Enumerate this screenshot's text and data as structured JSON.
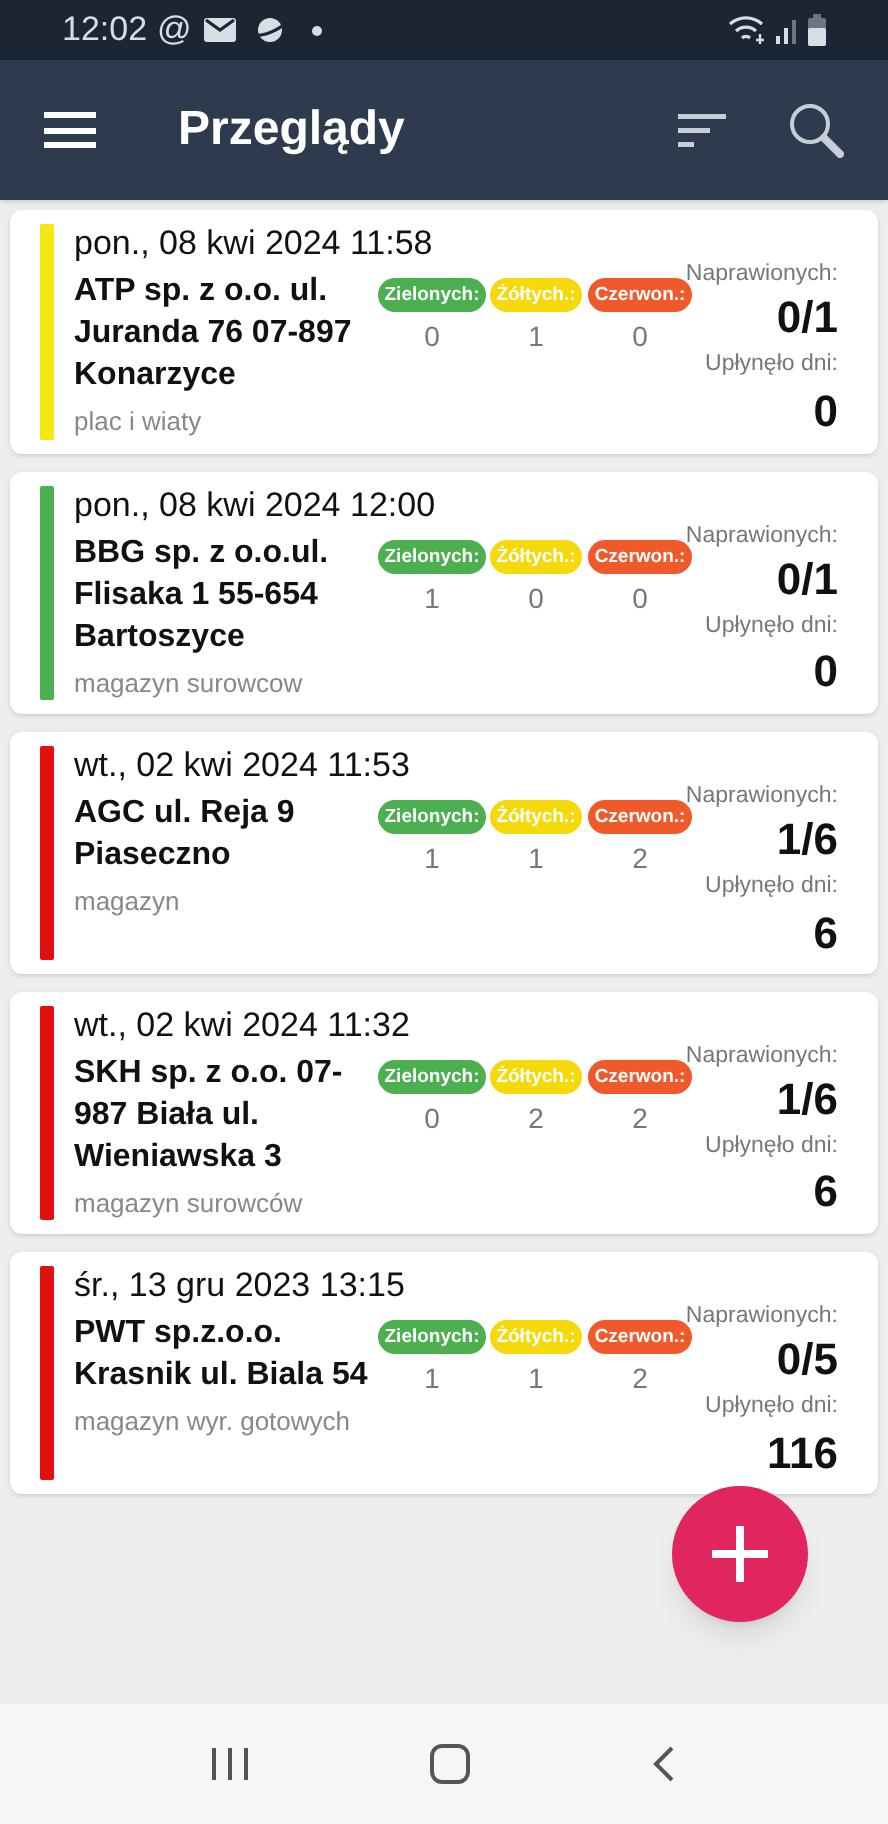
{
  "status_bar": {
    "time": "12:02",
    "at": "@"
  },
  "app_bar": {
    "title": "Przeglądy"
  },
  "inspections": [
    {
      "color": "#f5e614",
      "date": "pon., 08 kwi 2024 11:58",
      "name": "ATP sp. z o.o. ul. Juranda 76 07-897 Konarzyce",
      "location": "plac i wiaty",
      "badges": [
        {
          "label": "Zielonych:",
          "color": "#4caf50",
          "count": "0"
        },
        {
          "label": "Żółtych.:",
          "color": "#f5d90a",
          "count": "1"
        },
        {
          "label": "Czerwon.:",
          "color": "#f0592a",
          "count": "0"
        }
      ],
      "repaired_label": "Naprawionych:",
      "repaired": "0/1",
      "days_label": "Upłynęło dni:",
      "days": "0"
    },
    {
      "color": "#4caf50",
      "date": "pon., 08 kwi 2024 12:00",
      "name": "BBG sp. z o.o.ul. Flisaka 1 55-654 Bartoszyce",
      "location": "magazyn surowcow",
      "badges": [
        {
          "label": "Zielonych:",
          "color": "#4caf50",
          "count": "1"
        },
        {
          "label": "Żółtych.:",
          "color": "#f5d90a",
          "count": "0"
        },
        {
          "label": "Czerwon.:",
          "color": "#f0592a",
          "count": "0"
        }
      ],
      "repaired_label": "Naprawionych:",
      "repaired": "0/1",
      "days_label": "Upłynęło dni:",
      "days": "0"
    },
    {
      "color": "#e01010",
      "date": "wt., 02 kwi 2024 11:53",
      "name": "AGC ul. Reja 9 Piaseczno",
      "location": "magazyn",
      "badges": [
        {
          "label": "Zielonych:",
          "color": "#4caf50",
          "count": "1"
        },
        {
          "label": "Żółtych.:",
          "color": "#f5d90a",
          "count": "1"
        },
        {
          "label": "Czerwon.:",
          "color": "#f0592a",
          "count": "2"
        }
      ],
      "repaired_label": "Naprawionych:",
      "repaired": "1/6",
      "days_label": "Upłynęło dni:",
      "days": "6"
    },
    {
      "color": "#e01010",
      "date": "wt., 02 kwi 2024 11:32",
      "name": "SKH sp. z o.o. 07-987 Biała ul. Wieniawska 3",
      "location": "magazyn surowców",
      "badges": [
        {
          "label": "Zielonych:",
          "color": "#4caf50",
          "count": "0"
        },
        {
          "label": "Żółtych.:",
          "color": "#f5d90a",
          "count": "2"
        },
        {
          "label": "Czerwon.:",
          "color": "#f0592a",
          "count": "2"
        }
      ],
      "repaired_label": "Naprawionych:",
      "repaired": "1/6",
      "days_label": "Upłynęło dni:",
      "days": "6"
    },
    {
      "color": "#e01010",
      "date": "śr., 13 gru 2023 13:15",
      "name": "PWT sp.z.o.o. Krasnik ul. Biala 54",
      "location": "magazyn wyr. gotowych",
      "badges": [
        {
          "label": "Zielonych:",
          "color": "#4caf50",
          "count": "1"
        },
        {
          "label": "Żółtych.:",
          "color": "#f5d90a",
          "count": "1"
        },
        {
          "label": "Czerwon.:",
          "color": "#f0592a",
          "count": "2"
        }
      ],
      "repaired_label": "Naprawionych:",
      "repaired": "0/5",
      "days_label": "Upłynęło dni:",
      "days": "116"
    }
  ]
}
